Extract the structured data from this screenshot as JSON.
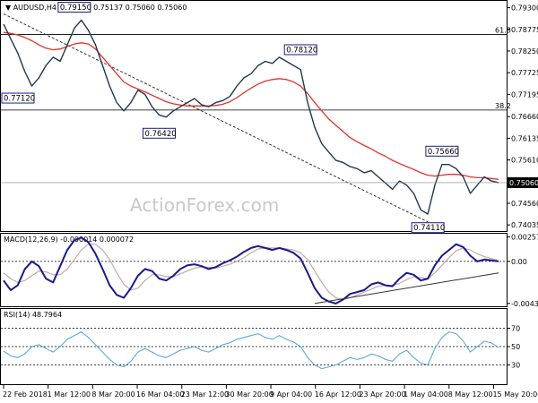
{
  "chart_data": [
    {
      "type": "line",
      "panel": "price",
      "symbol": "AUDUSD,H4",
      "ohlc_text": "0.75123 0.75137 0.75060 0.75060",
      "watermark": "ActionForex.com",
      "last_price": "0.75060",
      "y_ticks": [
        "0.79300",
        "0.78775",
        "0.78250",
        "0.77725",
        "0.77195",
        "0.76660",
        "0.76135",
        "0.75610",
        "0.75060",
        "0.74560",
        "0.74035"
      ],
      "ylim": [
        0.7393,
        0.794
      ],
      "fib_levels": [
        {
          "label": "61.8",
          "value": 0.7865
        },
        {
          "label": "38.2",
          "value": 0.7682
        }
      ],
      "price_labels": [
        {
          "text": "0.79150",
          "x_index": 10,
          "value": 0.7915
        },
        {
          "text": "0.77120",
          "x_index": 0,
          "value": 0.7712
        },
        {
          "text": "0.76420",
          "x_index": 22,
          "value": 0.7642
        },
        {
          "text": "0.78120",
          "x_index": 42,
          "value": 0.7812
        },
        {
          "text": "0.75660",
          "x_index": 62,
          "value": 0.7566
        },
        {
          "text": "0.74110",
          "x_index": 60,
          "value": 0.7411
        }
      ],
      "close": [
        0.789,
        0.7855,
        0.782,
        0.7775,
        0.774,
        0.776,
        0.779,
        0.781,
        0.78,
        0.784,
        0.788,
        0.79,
        0.7875,
        0.784,
        0.779,
        0.774,
        0.77,
        0.768,
        0.77,
        0.773,
        0.772,
        0.769,
        0.767,
        0.7665,
        0.768,
        0.769,
        0.77,
        0.771,
        0.7695,
        0.769,
        0.77,
        0.7705,
        0.7715,
        0.774,
        0.776,
        0.777,
        0.779,
        0.78,
        0.7795,
        0.781,
        0.78,
        0.779,
        0.778,
        0.77,
        0.764,
        0.76,
        0.758,
        0.756,
        0.7555,
        0.7545,
        0.754,
        0.753,
        0.7535,
        0.752,
        0.7505,
        0.749,
        0.751,
        0.75,
        0.748,
        0.744,
        0.743,
        0.75,
        0.755,
        0.755,
        0.754,
        0.752,
        0.748,
        0.75,
        0.752,
        0.751,
        0.7506
      ],
      "ma": [
        0.787,
        0.7868,
        0.7864,
        0.7858,
        0.785,
        0.784,
        0.7832,
        0.7828,
        0.783,
        0.7836,
        0.7842,
        0.7845,
        0.7842,
        0.783,
        0.781,
        0.779,
        0.777,
        0.775,
        0.774,
        0.7733,
        0.7726,
        0.7718,
        0.771,
        0.7702,
        0.7697,
        0.7694,
        0.7692,
        0.7692,
        0.7692,
        0.7692,
        0.7693,
        0.7696,
        0.7702,
        0.7712,
        0.7724,
        0.7735,
        0.7745,
        0.7752,
        0.7756,
        0.7758,
        0.7756,
        0.775,
        0.774,
        0.7722,
        0.77,
        0.768,
        0.766,
        0.7645,
        0.763,
        0.7615,
        0.7605,
        0.7596,
        0.7588,
        0.7578,
        0.757,
        0.756,
        0.7552,
        0.7545,
        0.7538,
        0.753,
        0.7524,
        0.7522,
        0.7524,
        0.7526,
        0.7526,
        0.7524,
        0.752,
        0.7518,
        0.7518,
        0.7516,
        0.7514
      ],
      "trendline": {
        "from": {
          "x_index": 0,
          "value": 0.7915
        },
        "to": {
          "x_index": 60,
          "value": 0.7411
        }
      }
    },
    {
      "type": "line",
      "panel": "macd",
      "label": "MACD(12,26,9) -0.000014 0.000072",
      "y_ticks": [
        "0.00257",
        "0.00",
        "-0.004392"
      ],
      "ylim": [
        -0.0046,
        0.0028
      ],
      "series": [
        {
          "name": "MACD",
          "values": [
            -0.002,
            -0.003,
            -0.0025,
            -0.0008,
            0.0,
            -0.0005,
            -0.0018,
            -0.0022,
            -0.0005,
            0.0012,
            0.0022,
            0.0025,
            0.002,
            0.0008,
            -0.0008,
            -0.0025,
            -0.0035,
            -0.0038,
            -0.0028,
            -0.0015,
            -0.0008,
            -0.001,
            -0.0018,
            -0.002,
            -0.0015,
            -0.0008,
            -0.0004,
            -0.0003,
            -0.0005,
            -0.0008,
            -0.0006,
            -0.0002,
            0.0001,
            0.0005,
            0.001,
            0.0014,
            0.0016,
            0.0014,
            0.0012,
            0.0014,
            0.0012,
            0.0009,
            0.0003,
            -0.0012,
            -0.0028,
            -0.0038,
            -0.0042,
            -0.0044,
            -0.004,
            -0.0034,
            -0.0032,
            -0.003,
            -0.0024,
            -0.0022,
            -0.0025,
            -0.0026,
            -0.0018,
            -0.0012,
            -0.0014,
            -0.002,
            -0.0018,
            -0.0004,
            0.0006,
            0.0012,
            0.0018,
            0.0015,
            0.0006,
            0.0,
            0.0002,
            0.0001,
            0.0
          ]
        },
        {
          "name": "Signal",
          "values": [
            -0.0012,
            -0.0018,
            -0.0022,
            -0.002,
            -0.0015,
            -0.001,
            -0.0011,
            -0.0014,
            -0.0014,
            -0.0008,
            0.0002,
            0.0012,
            0.0018,
            0.0018,
            0.0012,
            0.0002,
            -0.0012,
            -0.0024,
            -0.003,
            -0.0028,
            -0.002,
            -0.0014,
            -0.0014,
            -0.0016,
            -0.0016,
            -0.0013,
            -0.001,
            -0.0007,
            -0.0006,
            -0.0006,
            -0.0007,
            -0.0005,
            -0.0003,
            0.0,
            0.0004,
            0.0009,
            0.0013,
            0.0014,
            0.0014,
            0.0014,
            0.0013,
            0.0012,
            0.0009,
            0.0002,
            -0.001,
            -0.0022,
            -0.0032,
            -0.0038,
            -0.004,
            -0.0038,
            -0.0035,
            -0.0032,
            -0.0029,
            -0.0026,
            -0.0025,
            -0.0025,
            -0.0023,
            -0.0019,
            -0.0016,
            -0.0017,
            -0.0018,
            -0.0012,
            -0.0004,
            0.0004,
            0.0011,
            0.0014,
            0.0012,
            0.0008,
            0.0005,
            0.0003,
            0.0001
          ]
        }
      ],
      "trendline": {
        "from": {
          "x_index": 44,
          "value": -0.0044
        },
        "to": {
          "x_index": 70,
          "value": -0.0012
        }
      }
    },
    {
      "type": "line",
      "panel": "rsi",
      "label": "RSI(14) 48.7964",
      "y_ticks": [
        "70",
        "50",
        "30"
      ],
      "ylim": [
        10,
        90
      ],
      "levels": [
        70,
        50,
        30
      ],
      "series": [
        {
          "name": "RSI",
          "values": [
            45,
            40,
            38,
            42,
            50,
            52,
            48,
            44,
            50,
            58,
            62,
            66,
            60,
            52,
            44,
            36,
            30,
            28,
            34,
            44,
            48,
            44,
            40,
            38,
            42,
            46,
            48,
            50,
            46,
            44,
            48,
            52,
            54,
            58,
            60,
            62,
            64,
            60,
            58,
            62,
            58,
            55,
            50,
            38,
            30,
            26,
            28,
            30,
            34,
            38,
            36,
            38,
            42,
            40,
            36,
            34,
            42,
            46,
            38,
            32,
            30,
            48,
            60,
            66,
            64,
            56,
            44,
            50,
            56,
            54,
            49
          ]
        }
      ]
    }
  ],
  "x_axis": {
    "labels": [
      "22 Feb 2018",
      "1 Mar 12:00",
      "8 Mar 20:00",
      "16 Mar 04:00",
      "23 Mar 12:00",
      "30 Mar 20:00",
      "9 Apr 04:00",
      "16 Apr 12:00",
      "23 Apr 20:00",
      "1 May 04:00",
      "8 May 12:00",
      "15 May 20:00"
    ],
    "label_indices": [
      0,
      6.3,
      12.6,
      18.9,
      25.2,
      31.5,
      37.8,
      44.1,
      50.4,
      56.7,
      63,
      69.3
    ]
  },
  "colors": {
    "price": "#1f3a4d",
    "ma": "#e0332c",
    "macd": "#1a1a8c",
    "signal": "#c8a8a8",
    "rsi": "#5aa8e0",
    "grid": "#000000",
    "trendline": "#333333"
  }
}
